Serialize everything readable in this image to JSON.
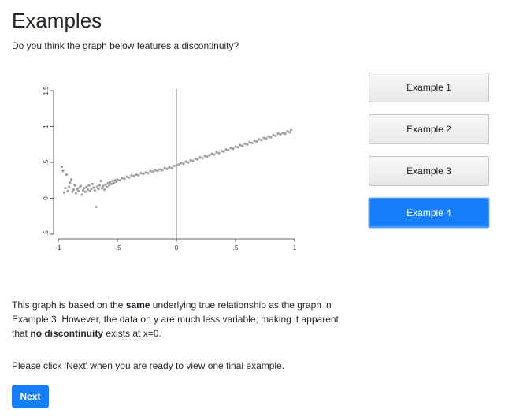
{
  "page": {
    "title": "Examples",
    "question": "Do you think the graph below features a discontinuity?"
  },
  "examples": {
    "buttons": [
      {
        "label": "Example 1",
        "active": false
      },
      {
        "label": "Example 2",
        "active": false
      },
      {
        "label": "Example 3",
        "active": false
      },
      {
        "label": "Example 4",
        "active": true
      }
    ]
  },
  "explanation": {
    "before_same": "This graph is based on the ",
    "same": "same",
    "after_same": " underlying true relationship as the graph in Example 3. However, the data on y are much less variable, making it apparent that ",
    "no_discontinuity": "no discontinuity",
    "after_no_discontinuity": " exists at x=0."
  },
  "prompt": {
    "text": "Please click 'Next' when you are ready to view one final example."
  },
  "next_button": {
    "label": "Next"
  },
  "colors": {
    "accent": "#147efb",
    "points": "#a0a0a0",
    "axis": "#333333"
  },
  "chart_data": {
    "type": "scatter",
    "xlim": [
      -1,
      1
    ],
    "ylim": [
      -0.5,
      1.5
    ],
    "x_ticks": [
      -1,
      -0.5,
      0,
      0.5,
      1
    ],
    "x_tick_labels": [
      "-1",
      "-.5",
      "0",
      ".5",
      "1"
    ],
    "y_ticks": [
      -0.5,
      0,
      0.5,
      1,
      1.5
    ],
    "y_tick_labels": [
      "-.5",
      "0",
      ".5",
      "1",
      "1.5"
    ],
    "vline_x": 0,
    "series": [
      {
        "points": [
          [
            -0.97,
            0.44
          ],
          [
            -0.96,
            0.38
          ],
          [
            -0.95,
            0.08
          ],
          [
            -0.94,
            0.14
          ],
          [
            -0.93,
            0.33
          ],
          [
            -0.92,
            0.1
          ],
          [
            -0.91,
            0.16
          ],
          [
            -0.9,
            0.22
          ],
          [
            -0.89,
            0.26
          ],
          [
            -0.88,
            0.09
          ],
          [
            -0.87,
            0.12
          ],
          [
            -0.86,
            0.18
          ],
          [
            -0.85,
            0.07
          ],
          [
            -0.84,
            0.13
          ],
          [
            -0.83,
            0.1
          ],
          [
            -0.82,
            0.15
          ],
          [
            -0.81,
            0.17
          ],
          [
            -0.8,
            0.05
          ],
          [
            -0.79,
            0.11
          ],
          [
            -0.78,
            0.14
          ],
          [
            -0.77,
            0.09
          ],
          [
            -0.76,
            0.16
          ],
          [
            -0.75,
            0.12
          ],
          [
            -0.74,
            0.18
          ],
          [
            -0.73,
            0.1
          ],
          [
            -0.72,
            0.13
          ],
          [
            -0.71,
            0.2
          ],
          [
            -0.7,
            0.15
          ],
          [
            -0.69,
            0.11
          ],
          [
            -0.68,
            -0.12
          ],
          [
            -0.67,
            0.16
          ],
          [
            -0.66,
            0.13
          ],
          [
            -0.65,
            0.18
          ],
          [
            -0.64,
            0.24
          ],
          [
            -0.63,
            0.14
          ],
          [
            -0.62,
            0.17
          ],
          [
            -0.61,
            0.12
          ],
          [
            -0.6,
            0.19
          ],
          [
            -0.59,
            0.16
          ],
          [
            -0.58,
            0.21
          ],
          [
            -0.57,
            0.18
          ],
          [
            -0.56,
            0.22
          ],
          [
            -0.55,
            0.2
          ],
          [
            -0.54,
            0.24
          ],
          [
            -0.53,
            0.21
          ],
          [
            -0.52,
            0.25
          ],
          [
            -0.51,
            0.23
          ],
          [
            -0.5,
            0.26
          ],
          [
            -0.48,
            0.25
          ],
          [
            -0.46,
            0.28
          ],
          [
            -0.44,
            0.27
          ],
          [
            -0.42,
            0.3
          ],
          [
            -0.4,
            0.29
          ],
          [
            -0.38,
            0.32
          ],
          [
            -0.36,
            0.31
          ],
          [
            -0.34,
            0.33
          ],
          [
            -0.32,
            0.32
          ],
          [
            -0.3,
            0.35
          ],
          [
            -0.28,
            0.34
          ],
          [
            -0.26,
            0.36
          ],
          [
            -0.24,
            0.35
          ],
          [
            -0.22,
            0.38
          ],
          [
            -0.2,
            0.37
          ],
          [
            -0.18,
            0.39
          ],
          [
            -0.16,
            0.38
          ],
          [
            -0.14,
            0.4
          ],
          [
            -0.12,
            0.39
          ],
          [
            -0.1,
            0.42
          ],
          [
            -0.08,
            0.41
          ],
          [
            -0.06,
            0.43
          ],
          [
            -0.04,
            0.42
          ],
          [
            -0.02,
            0.45
          ],
          [
            0.0,
            0.46
          ],
          [
            0.02,
            0.47
          ],
          [
            0.04,
            0.49
          ],
          [
            0.06,
            0.48
          ],
          [
            0.08,
            0.51
          ],
          [
            0.1,
            0.5
          ],
          [
            0.12,
            0.53
          ],
          [
            0.14,
            0.52
          ],
          [
            0.16,
            0.55
          ],
          [
            0.18,
            0.54
          ],
          [
            0.2,
            0.57
          ],
          [
            0.22,
            0.56
          ],
          [
            0.24,
            0.59
          ],
          [
            0.26,
            0.58
          ],
          [
            0.28,
            0.6
          ],
          [
            0.3,
            0.62
          ],
          [
            0.32,
            0.61
          ],
          [
            0.34,
            0.64
          ],
          [
            0.36,
            0.63
          ],
          [
            0.38,
            0.66
          ],
          [
            0.4,
            0.65
          ],
          [
            0.42,
            0.68
          ],
          [
            0.44,
            0.67
          ],
          [
            0.46,
            0.7
          ],
          [
            0.48,
            0.69
          ],
          [
            0.5,
            0.72
          ],
          [
            0.52,
            0.71
          ],
          [
            0.54,
            0.74
          ],
          [
            0.56,
            0.73
          ],
          [
            0.58,
            0.76
          ],
          [
            0.6,
            0.75
          ],
          [
            0.62,
            0.78
          ],
          [
            0.64,
            0.77
          ],
          [
            0.66,
            0.8
          ],
          [
            0.68,
            0.79
          ],
          [
            0.7,
            0.82
          ],
          [
            0.72,
            0.81
          ],
          [
            0.74,
            0.84
          ],
          [
            0.76,
            0.83
          ],
          [
            0.78,
            0.86
          ],
          [
            0.8,
            0.85
          ],
          [
            0.82,
            0.88
          ],
          [
            0.84,
            0.87
          ],
          [
            0.86,
            0.9
          ],
          [
            0.88,
            0.89
          ],
          [
            0.9,
            0.91
          ],
          [
            0.92,
            0.9
          ],
          [
            0.94,
            0.93
          ],
          [
            0.96,
            0.92
          ],
          [
            0.97,
            0.95
          ]
        ]
      }
    ]
  }
}
